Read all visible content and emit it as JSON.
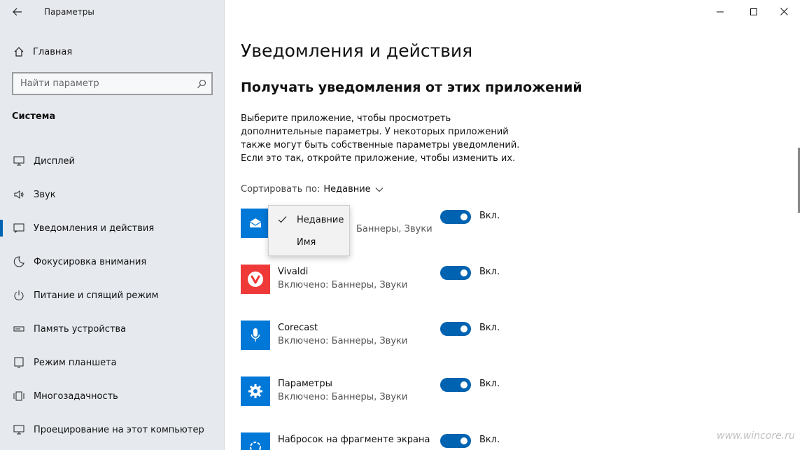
{
  "window": {
    "title": "Параметры"
  },
  "sidebar": {
    "home_label": "Главная",
    "search_placeholder": "Найти параметр",
    "section_title": "Система",
    "items": [
      {
        "label": "Дисплей",
        "icon": "monitor-icon"
      },
      {
        "label": "Звук",
        "icon": "speaker-icon"
      },
      {
        "label": "Уведомления и действия",
        "icon": "notification-icon",
        "active": true
      },
      {
        "label": "Фокусировка внимания",
        "icon": "moon-icon"
      },
      {
        "label": "Питание и спящий режим",
        "icon": "power-icon"
      },
      {
        "label": "Память устройства",
        "icon": "storage-icon"
      },
      {
        "label": "Режим планшета",
        "icon": "tablet-icon"
      },
      {
        "label": "Многозадачность",
        "icon": "multitask-icon"
      },
      {
        "label": "Проецирование на этот компьютер",
        "icon": "project-icon"
      }
    ]
  },
  "main": {
    "title": "Уведомления и действия",
    "subtitle": "Получать уведомления от этих приложений",
    "description": "Выберите приложение, чтобы просмотреть дополнительные параметры. У некоторых приложений также могут быть собственные параметры уведомлений. Если это так, откройте приложение, чтобы изменить их.",
    "sort_label": "Сортировать по:",
    "sort_value": "Недавние",
    "apps": [
      {
        "name": "",
        "status": "Включено: Баннеры, Звуки",
        "status_visible": "Баннеры, Звуки",
        "toggle_label": "Вкл.",
        "icon": "mail-icon",
        "tile_color": "#0078d7"
      },
      {
        "name": "Vivaldi",
        "status": "Включено: Баннеры, Звуки",
        "toggle_label": "Вкл.",
        "icon": "vivaldi-icon",
        "tile_color": "#ef3939"
      },
      {
        "name": "Corecast",
        "status": "Включено: Баннеры, Звуки",
        "toggle_label": "Вкл.",
        "icon": "microphone-icon",
        "tile_color": "#0078d7"
      },
      {
        "name": "Параметры",
        "status": "Включено: Баннеры, Звуки",
        "toggle_label": "Вкл.",
        "icon": "gear-icon",
        "tile_color": "#0078d7"
      },
      {
        "name": "Набросок на фрагменте экрана",
        "status": "",
        "toggle_label": "Вкл.",
        "icon": "snip-icon",
        "tile_color": "#0078d7"
      }
    ]
  },
  "dropdown": {
    "options": [
      {
        "label": "Недавние",
        "selected": true
      },
      {
        "label": "Имя",
        "selected": false
      }
    ]
  },
  "watermark": "www.wincore.ru",
  "colors": {
    "accent": "#0063b1",
    "sidebar_bg": "#e6e9ee",
    "tile_blue": "#0078d7",
    "vivaldi_red": "#ef3939"
  }
}
